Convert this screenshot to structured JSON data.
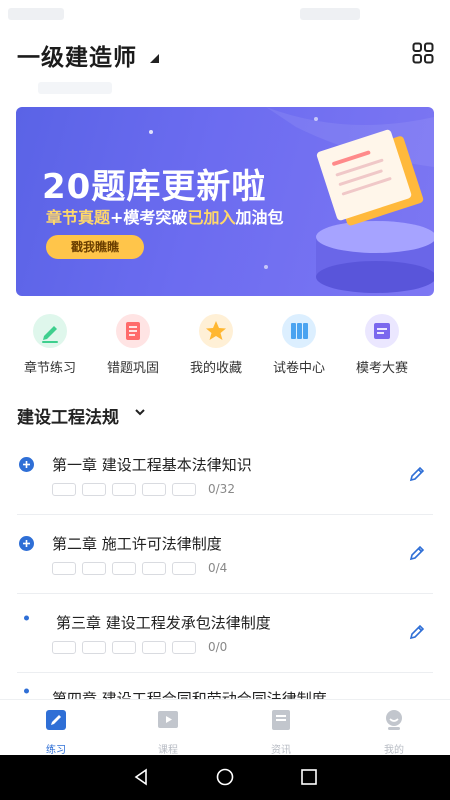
{
  "header": {
    "title": "一级建造师"
  },
  "banner": {
    "headline": "20",
    "headline_rest": "题库更新啦",
    "sub_part1": "章节真题",
    "sub_part2": "+模考突破",
    "sub_part3": "已加入",
    "sub_part4": "加油包",
    "cta": "戳我瞧瞧"
  },
  "quick_actions": [
    {
      "label": "章节练习",
      "color": "#3ecf8e"
    },
    {
      "label": "错题巩固",
      "color": "#ff6b6b"
    },
    {
      "label": "我的收藏",
      "color": "#ffb731"
    },
    {
      "label": "试卷中心",
      "color": "#4aa3f0"
    },
    {
      "label": "模考大赛",
      "color": "#7b68ee"
    }
  ],
  "section": {
    "title": "建设工程法规"
  },
  "chapters": [
    {
      "name": "第一章 建设工程基本法律知识",
      "count": "0/32"
    },
    {
      "name": "第二章 施工许可法律制度",
      "count": "0/4"
    },
    {
      "name": "第三章 建设工程发承包法律制度",
      "count": "0/0"
    },
    {
      "name": "第四章 建设工程合同和劳动合同法律制度",
      "count": ""
    }
  ],
  "tabs": [
    {
      "label": "练习",
      "active": true
    },
    {
      "label": "课程",
      "active": false
    },
    {
      "label": "资讯",
      "active": false
    },
    {
      "label": "我的",
      "active": false
    }
  ],
  "colors": {
    "accent": "#2f6fd6",
    "inactive": "#b8bcc4",
    "banner": "#6a6cf0"
  }
}
